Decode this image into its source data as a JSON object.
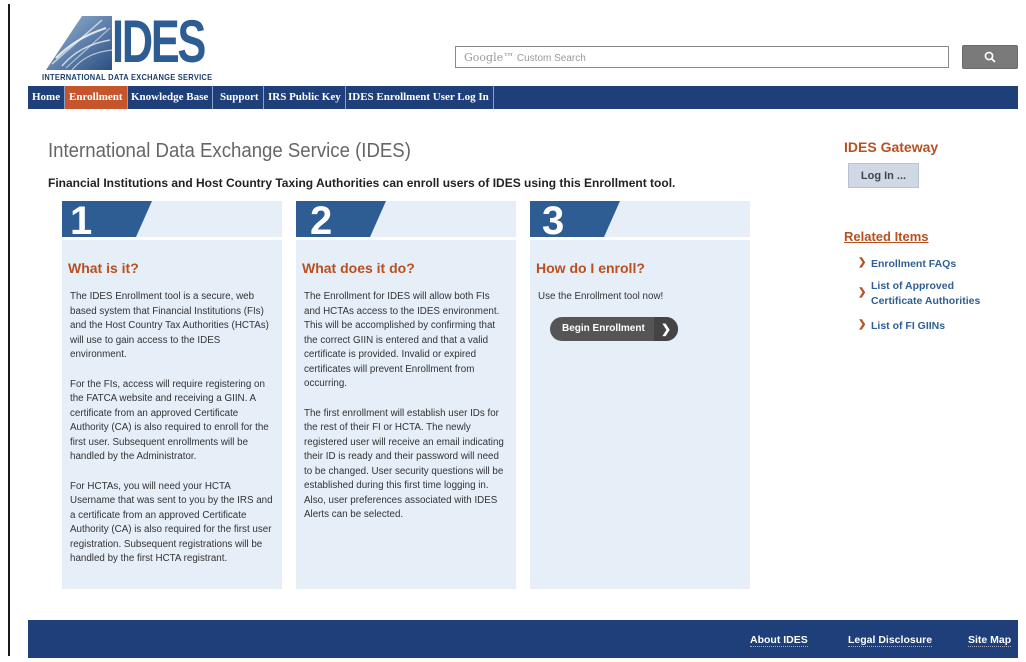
{
  "header": {
    "logo_text": "IDES",
    "logo_subtitle": "INTERNATIONAL DATA EXCHANGE SERVICE",
    "search_placeholder_brand": "Google™",
    "search_placeholder": "Custom Search",
    "search_icon": "magnifier-icon"
  },
  "nav": {
    "items": [
      "Home",
      "Enrollment",
      "Knowledge Base",
      "Support",
      "IRS Public Key",
      "IDES Enrollment User Log In"
    ],
    "active": "Enrollment"
  },
  "main": {
    "title": "International Data Exchange Service (IDES)",
    "intro": "Financial Institutions and Host Country Taxing Authorities can enroll users of IDES using this Enrollment tool.",
    "steps": [
      {
        "number": "1",
        "heading": "What is it?",
        "paragraphs": [
          "The IDES Enrollment tool is a secure, web based system that Financial Institutions (FIs) and the Host Country Tax Authorities (HCTAs) will use to gain access to the IDES environment.",
          "For the FIs, access will require registering on the FATCA website and receiving a GIIN. A certificate from an approved Certificate Authority (CA) is also required to enroll for the first user. Subsequent enrollments will be handled by the Administrator.",
          "For HCTAs, you will need your HCTA Username that was sent to you by the IRS and a certificate from an approved Certificate Authority (CA) is also required for the first user registration. Subsequent registrations will be handled by the first HCTA registrant."
        ]
      },
      {
        "number": "2",
        "heading": "What does it do?",
        "paragraphs": [
          "The Enrollment for IDES will allow both FIs and HCTAs access to the IDES environment. This will be accomplished by confirming that the correct GIIN is entered and that a valid certificate is provided. Invalid or expired certificates will prevent Enrollment from occurring.",
          "The first enrollment will establish user IDs for the rest of their FI or HCTA. The newly registered user will receive an email indicating their ID is ready and their password will need to be changed. User security questions will be established during this first time logging in. Also, user preferences associated with IDES Alerts can be selected."
        ]
      },
      {
        "number": "3",
        "heading": "How do I enroll?",
        "paragraphs": [
          "Use the Enrollment tool now!"
        ],
        "button": "Begin Enrollment"
      }
    ]
  },
  "sidebar": {
    "gateway_title": "IDES Gateway",
    "login_label": "Log In ...",
    "related_title": "Related Items",
    "related": [
      "Enrollment FAQs",
      "List of Approved Certificate Authorities",
      "List of FI GIINs"
    ]
  },
  "footer": {
    "links": [
      "About IDES",
      "Legal Disclosure",
      "Site Map"
    ]
  },
  "colors": {
    "nav_bg": "#1f3f7a",
    "active_tab": "#c7552b",
    "heading_orange": "#b85020",
    "panel_bg": "#e6eef8",
    "link_blue": "#2f5f93"
  }
}
